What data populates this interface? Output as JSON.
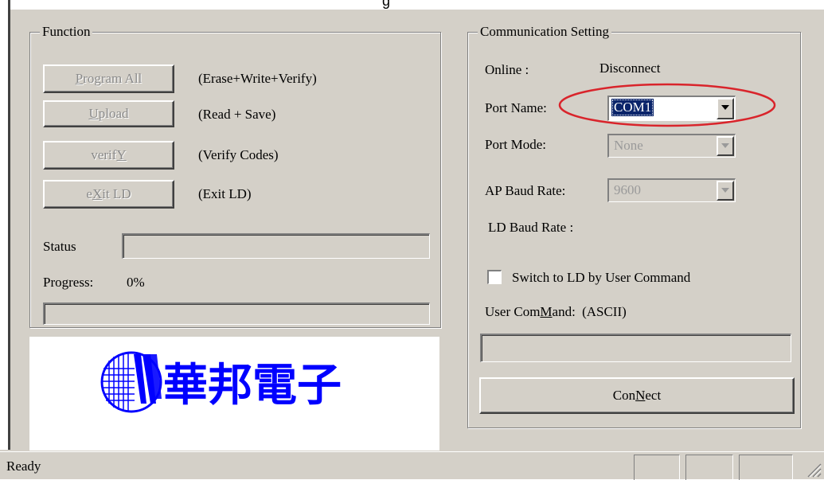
{
  "cut_off_title": "g",
  "function": {
    "title": "Function",
    "buttons": [
      {
        "pre": "",
        "ul": "P",
        "post": "rogram All",
        "desc": "(Erase+Write+Verify)"
      },
      {
        "pre": "",
        "ul": "U",
        "post": "pload",
        "desc": "(Read + Save)"
      },
      {
        "pre": "verif",
        "ul": "Y",
        "post": "",
        "desc": "(Verify Codes)"
      },
      {
        "pre": "e",
        "ul": "X",
        "post": "it LD",
        "desc": "(Exit LD)"
      }
    ],
    "status_label": "Status",
    "status_value": "",
    "progress_label": "Progress:",
    "progress_value": "0%"
  },
  "logo": {
    "text": "華邦電子",
    "brand_color": "#0000ff"
  },
  "comm": {
    "title": "Communication Setting",
    "online_label": "Online :",
    "online_value": "Disconnect",
    "port_name_label": "Port Name:",
    "port_name_value": "COM1",
    "port_mode_label": "Port Mode:",
    "port_mode_value": "None",
    "ap_baud_label": "AP Baud Rate:",
    "ap_baud_value": "9600",
    "ld_baud_label": "LD Baud Rate :",
    "switch_label": "Switch to LD by User Command",
    "switch_checked": false,
    "user_cmd_pre": "User Com",
    "user_cmd_ul": "M",
    "user_cmd_post": "and:",
    "user_cmd_hint": "(ASCII)",
    "user_cmd_value": "",
    "connect_pre": "Con",
    "connect_ul": "N",
    "connect_post": "ect"
  },
  "statusbar": {
    "text": "Ready"
  },
  "annotation_color": "#d9242b"
}
